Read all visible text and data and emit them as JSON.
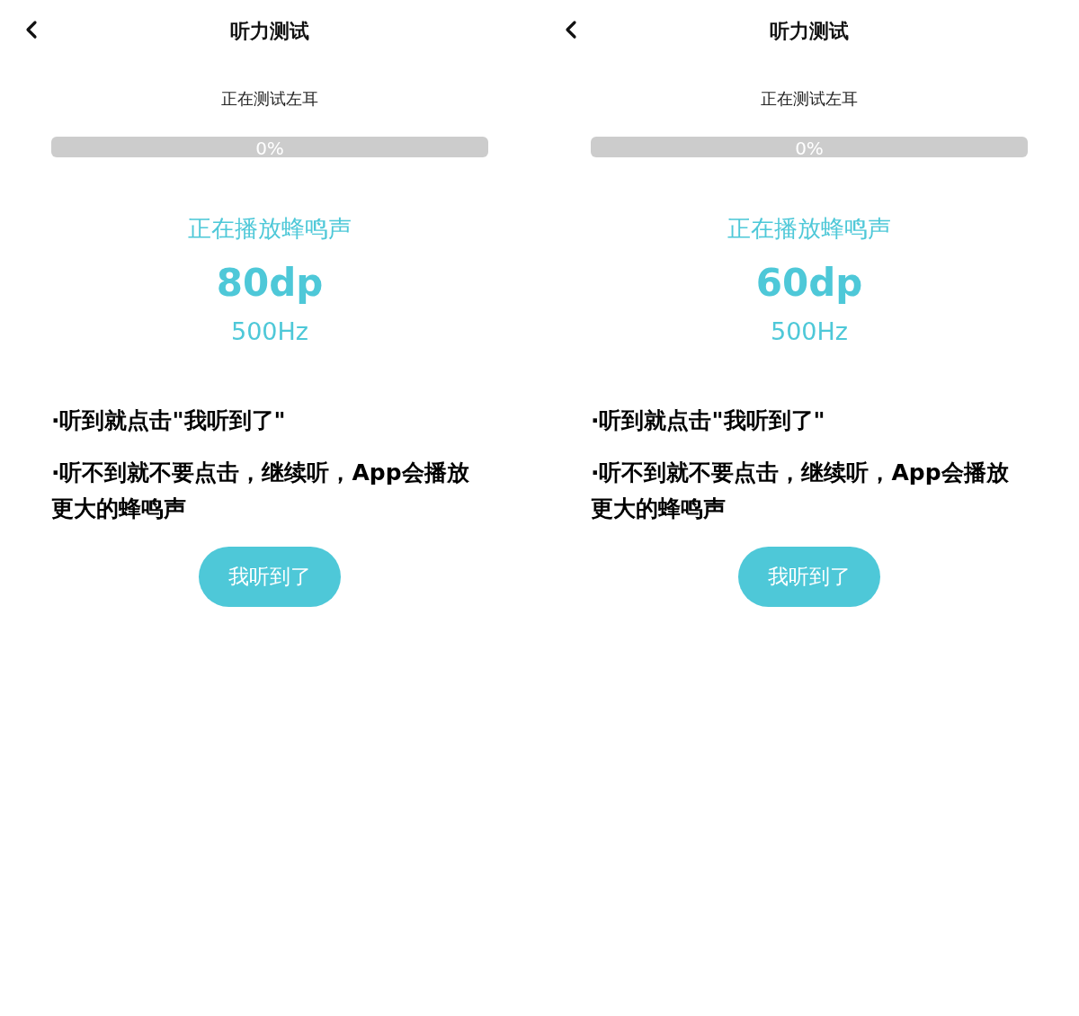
{
  "screens": [
    {
      "title": "听力测试",
      "subtitle": "正在测试左耳",
      "progress": {
        "level": 0,
        "label": "0%"
      },
      "status": "正在播放蜂鸣声",
      "volume": "80dp",
      "frequency": "500Hz",
      "instructions": [
        "·听到就点击\"我听到了\"",
        "·听不到就不要点击，继续听，App会播放更大的蜂鸣声"
      ],
      "button": "我听到了"
    },
    {
      "title": "听力测试",
      "subtitle": "正在测试左耳",
      "progress": {
        "level": 0,
        "label": "0%"
      },
      "status": "正在播放蜂鸣声",
      "volume": "60dp",
      "frequency": "500Hz",
      "instructions": [
        "·听到就点击\"我听到了\"",
        "·听不到就不要点击，继续听，App会播放更大的蜂鸣声"
      ],
      "button": "我听到了"
    }
  ]
}
